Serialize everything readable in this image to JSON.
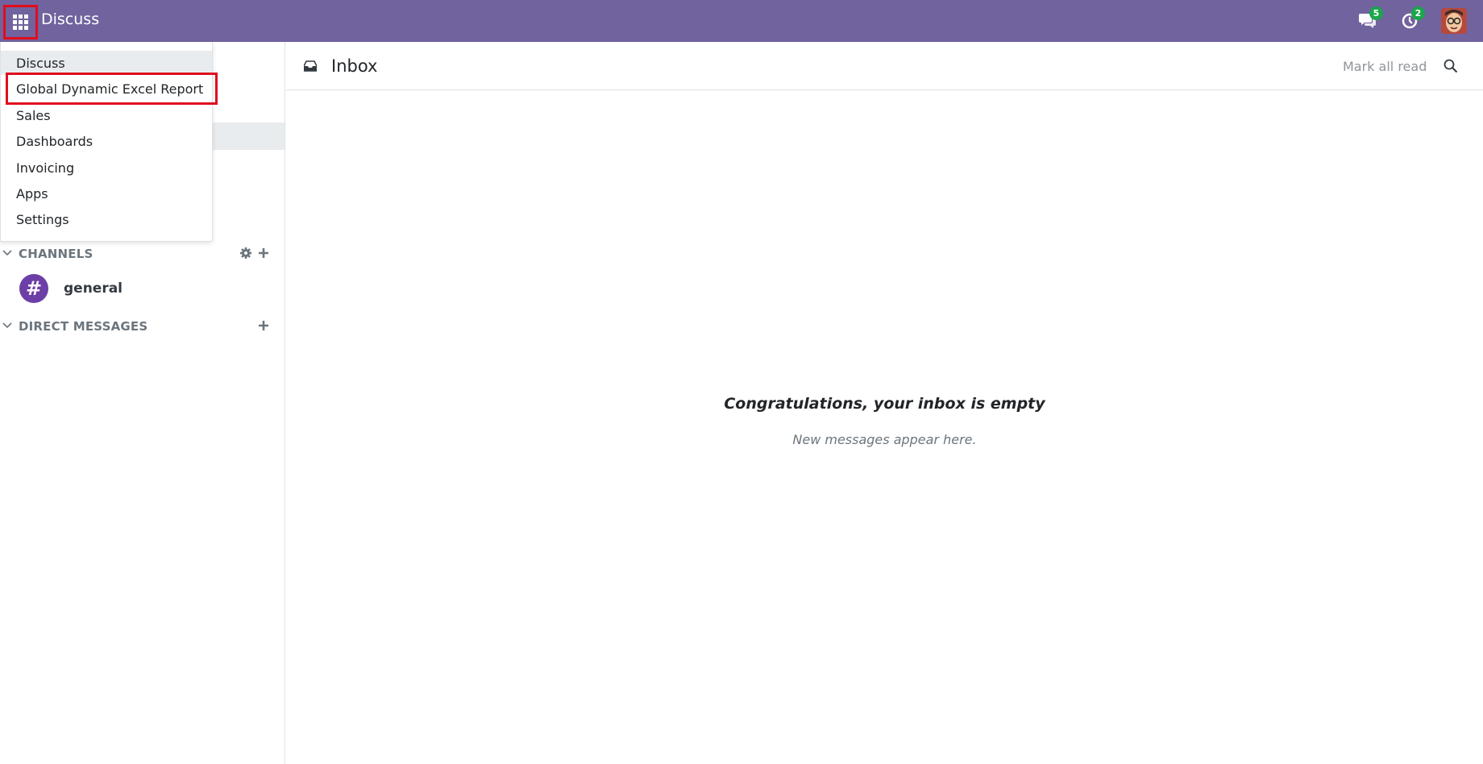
{
  "navbar": {
    "brand": "Discuss",
    "messages_badge": "5",
    "activities_badge": "2",
    "color": "#71639e"
  },
  "app_menu": {
    "items": [
      {
        "label": "Discuss"
      },
      {
        "label": "Global Dynamic Excel Report"
      },
      {
        "label": "Sales"
      },
      {
        "label": "Dashboards"
      },
      {
        "label": "Invoicing"
      },
      {
        "label": "Apps"
      },
      {
        "label": "Settings"
      }
    ]
  },
  "sidebar": {
    "channels_title": "CHANNELS",
    "channels": [
      {
        "name": "general",
        "icon": "hash-icon"
      }
    ],
    "direct_messages_title": "DIRECT MESSAGES"
  },
  "main": {
    "title": "Inbox",
    "mark_all_read": "Mark all read",
    "empty_title": "Congratulations, your inbox is empty",
    "empty_subtitle": "New messages appear here."
  },
  "icons": {
    "apps": "apps-grid-icon",
    "messages": "chat-bubbles-icon",
    "activities": "clock-icon",
    "inbox": "inbox-icon",
    "search": "search-icon",
    "settings": "gear-icon",
    "add": "plus-icon",
    "collapse": "chevron-down-icon"
  },
  "accent_colors": {
    "highlight_border": "#e00d1e",
    "badge": "#1aa64b",
    "channel_avatar": "#6c3fa6"
  }
}
